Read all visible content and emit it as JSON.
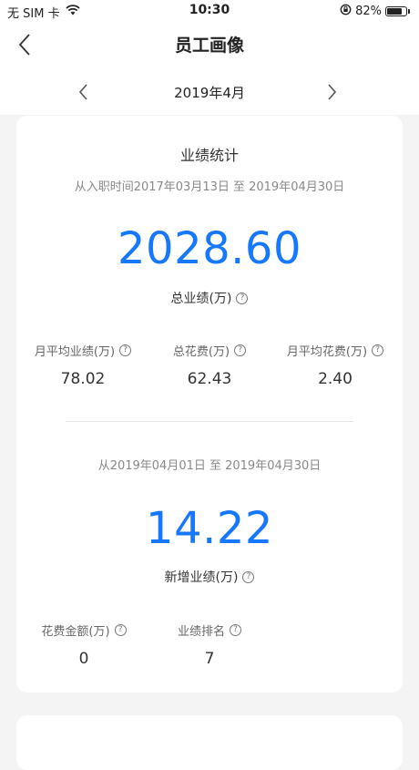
{
  "status_bar": {
    "carrier": "无 SIM 卡",
    "time": "10:30",
    "battery": "82%",
    "battery_level": 0.82
  },
  "nav": {
    "title": "员工画像"
  },
  "month": {
    "label": "2019年4月"
  },
  "summary": {
    "title": "业绩统计",
    "range": "从入职时间2017年03月13日 至 2019年04月30日",
    "total_value": "2028.60",
    "total_label": "总业绩(万)",
    "stats": [
      {
        "label": "月平均业绩(万)",
        "value": "78.02"
      },
      {
        "label": "总花费(万)",
        "value": "62.43"
      },
      {
        "label": "月平均花费(万)",
        "value": "2.40"
      }
    ]
  },
  "monthly": {
    "range": "从2019年04月01日 至 2019年04月30日",
    "new_value": "14.22",
    "new_label": "新增业绩(万)",
    "stats": [
      {
        "label": "花费金额(万)",
        "value": "0"
      },
      {
        "label": "业绩排名",
        "value": "7"
      }
    ]
  },
  "icons": {
    "help": "?",
    "accent_color": "#1677ff"
  }
}
